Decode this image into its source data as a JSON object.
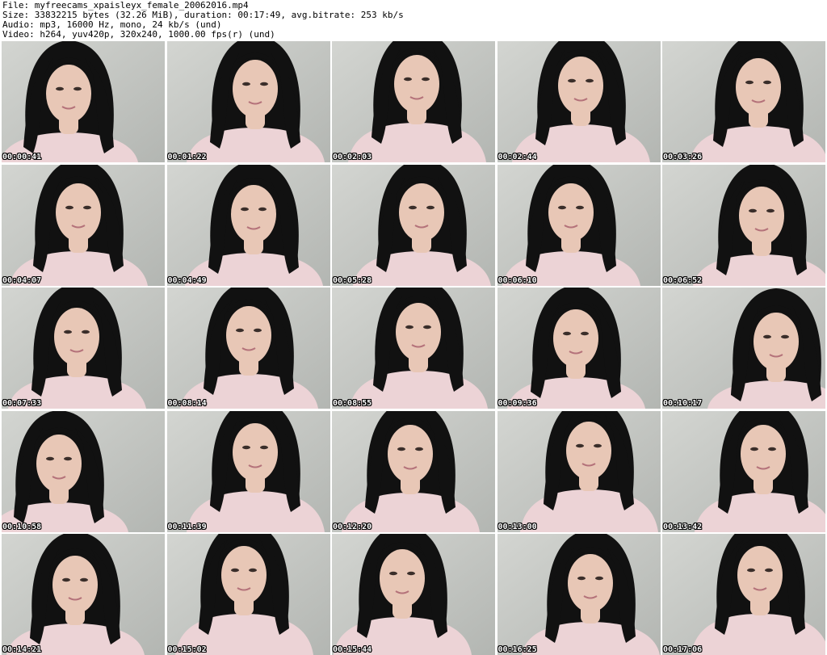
{
  "header": {
    "file": "File: myfreecams_xpaisleyx_female_20062016.mp4",
    "size": "Size: 33832215 bytes (32.26 MiB), duration: 00:17:49, avg.bitrate: 253 kb/s",
    "audio": "Audio: mp3, 16000 Hz, mono, 24 kb/s (und)",
    "video": "Video: h264, yuv420p, 320x240, 1000.00 fps(r) (und)"
  },
  "thumbnails": [
    {
      "timestamp": "00:00:41"
    },
    {
      "timestamp": "00:01:22"
    },
    {
      "timestamp": "00:02:03"
    },
    {
      "timestamp": "00:02:44"
    },
    {
      "timestamp": "00:03:26"
    },
    {
      "timestamp": "00:04:07"
    },
    {
      "timestamp": "00:04:49"
    },
    {
      "timestamp": "00:05:28"
    },
    {
      "timestamp": "00:06:10"
    },
    {
      "timestamp": "00:06:52"
    },
    {
      "timestamp": "00:07:33"
    },
    {
      "timestamp": "00:08:14"
    },
    {
      "timestamp": "00:08:55"
    },
    {
      "timestamp": "00:09:36"
    },
    {
      "timestamp": "00:10:17"
    },
    {
      "timestamp": "00:10:58"
    },
    {
      "timestamp": "00:11:39"
    },
    {
      "timestamp": "00:12:20"
    },
    {
      "timestamp": "00:13:00"
    },
    {
      "timestamp": "00:13:42"
    },
    {
      "timestamp": "00:14:21"
    },
    {
      "timestamp": "00:15:02"
    },
    {
      "timestamp": "00:15:44"
    },
    {
      "timestamp": "00:16:25"
    },
    {
      "timestamp": "00:17:06"
    }
  ],
  "colors": {
    "background": "#ffffff",
    "text": "#000000",
    "wall": "#c6c8c4",
    "hair": "#111111",
    "skin": "#e8c7b6",
    "top": "#ecd3d6",
    "timestamp": "#ffffff"
  }
}
